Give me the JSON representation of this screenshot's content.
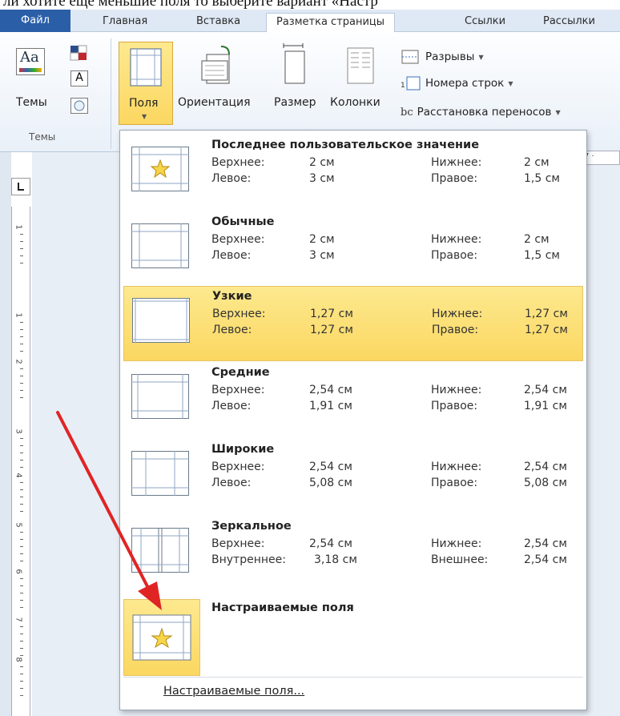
{
  "caption": "ли хотите еще меньшие поля то выберите вариант «Настр",
  "tabs": {
    "file": "Файл",
    "home": "Главная",
    "insert": "Вставка",
    "page_layout": "Разметка страницы",
    "references": "Ссылки",
    "mailings": "Рассылки"
  },
  "ribbon": {
    "themes_label": "Темы",
    "themes_group": "Темы",
    "margins_label": "Поля",
    "orientation_label": "Ориентация",
    "size_label": "Размер",
    "columns_label": "Колонки",
    "breaks_label": "Разрывы",
    "line_numbers_label": "Номера строк",
    "hyphenation_label": "Расстановка переносов",
    "ruler_text": "7 ·"
  },
  "margins_menu": {
    "items": [
      {
        "title": "Последнее пользовательское значение",
        "l1": "Верхнее:",
        "v1": "2 см",
        "r1": "Нижнее:",
        "w1": "2 см",
        "l2": "Левое:",
        "v2": "3 см",
        "r2": "Правое:",
        "w2": "1,5 см"
      },
      {
        "title": "Обычные",
        "l1": "Верхнее:",
        "v1": "2 см",
        "r1": "Нижнее:",
        "w1": "2 см",
        "l2": "Левое:",
        "v2": "3 см",
        "r2": "Правое:",
        "w2": "1,5 см"
      },
      {
        "title": "Узкие",
        "l1": "Верхнее:",
        "v1": "1,27 см",
        "r1": "Нижнее:",
        "w1": "1,27 см",
        "l2": "Левое:",
        "v2": "1,27 см",
        "r2": "Правое:",
        "w2": "1,27 см"
      },
      {
        "title": "Средние",
        "l1": "Верхнее:",
        "v1": "2,54 см",
        "r1": "Нижнее:",
        "w1": "2,54 см",
        "l2": "Левое:",
        "v2": "1,91 см",
        "r2": "Правое:",
        "w2": "1,91 см"
      },
      {
        "title": "Широкие",
        "l1": "Верхнее:",
        "v1": "2,54 см",
        "r1": "Нижнее:",
        "w1": "2,54 см",
        "l2": "Левое:",
        "v2": "5,08 см",
        "r2": "Правое:",
        "w2": "5,08 см"
      },
      {
        "title": "Зеркальное",
        "l1": "Верхнее:",
        "v1": "2,54 см",
        "r1": "Нижнее:",
        "w1": "2,54 см",
        "l2": "Внутреннее:",
        "v2": "3,18 см",
        "r2": "Внешнее:",
        "w2": "2,54 см"
      }
    ],
    "custom_title": "Настраиваемые поля",
    "footer_label": "Настраиваемые поля..."
  },
  "ruler_numbers": [
    "1",
    "1",
    "2",
    "3",
    "4",
    "5",
    "6",
    "7",
    "8"
  ],
  "colors": {
    "selected": "#fbd761",
    "accent_file_tab": "#2a5fa8",
    "arrow": "#e02424"
  }
}
